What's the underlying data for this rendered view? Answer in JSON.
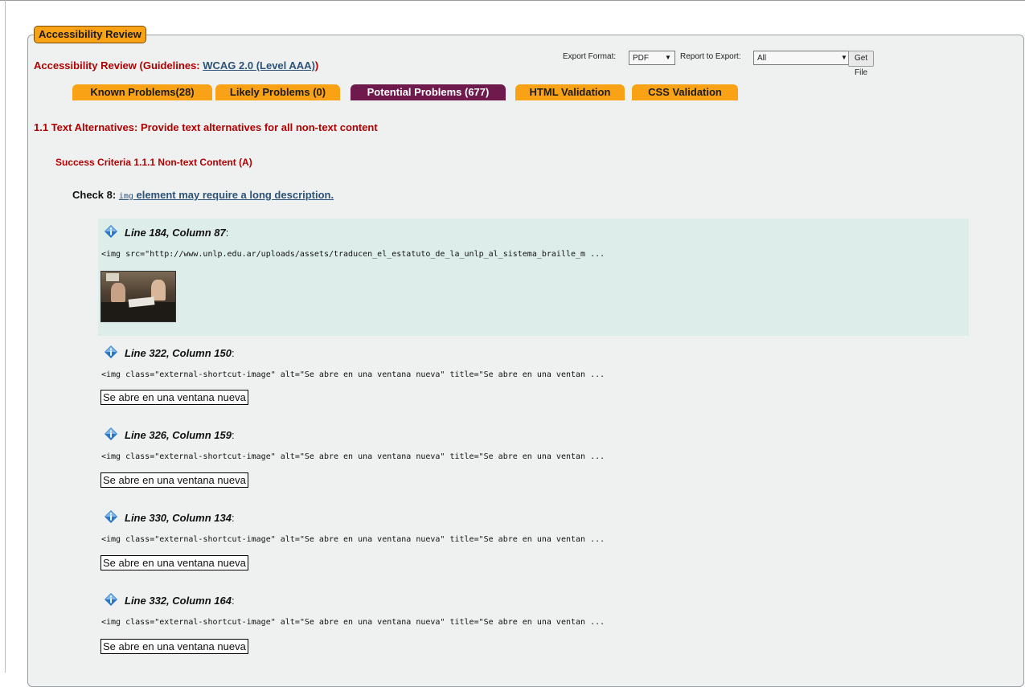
{
  "panel": {
    "legend": "Accessibility Review"
  },
  "title": {
    "prefix": "Accessibility Review (Guidelines: ",
    "link": "WCAG 2.0 (Level AAA)",
    "suffix": ")"
  },
  "export": {
    "format_label": "Export Format:",
    "format_value": "PDF",
    "report_label": "Report to Export:",
    "report_value": "All",
    "button": "Get File"
  },
  "tabs": [
    {
      "label": "Known Problems(28)",
      "active": false
    },
    {
      "label": "Likely Problems (0)",
      "active": false
    },
    {
      "label": "Potential Problems (677)",
      "active": true
    },
    {
      "label": "HTML Validation",
      "active": false
    },
    {
      "label": "CSS Validation",
      "active": false
    }
  ],
  "guideline": "1.1 Text Alternatives: Provide text alternatives for all non-text content",
  "success_criteria": "Success Criteria 1.1.1 Non-text Content (A)",
  "check": {
    "prefix": "Check 8: ",
    "code": "img",
    "link": " element may require a long description."
  },
  "items": [
    {
      "location": "Line 184, Column 87",
      "code": "<img src=\"http://www.unlp.edu.ar/uploads/assets/traducen_el_estatuto_de_la_unlp_al_sistema_braille_m ...",
      "alt": ""
    },
    {
      "location": "Line 322, Column 150",
      "code": "<img class=\"external-shortcut-image\" alt=\"Se abre en una ventana nueva\" title=\"Se abre en una ventan ...",
      "alt": "Se abre en una ventana nueva"
    },
    {
      "location": "Line 326, Column 159",
      "code": "<img class=\"external-shortcut-image\" alt=\"Se abre en una ventana nueva\" title=\"Se abre en una ventan ...",
      "alt": "Se abre en una ventana nueva"
    },
    {
      "location": "Line 330, Column 134",
      "code": "<img class=\"external-shortcut-image\" alt=\"Se abre en una ventana nueva\" title=\"Se abre en una ventan ...",
      "alt": "Se abre en una ventana nueva"
    },
    {
      "location": "Line 332, Column 164",
      "code": "<img class=\"external-shortcut-image\" alt=\"Se abre en una ventana nueva\" title=\"Se abre en una ventan ...",
      "alt": "Se abre en una ventana nueva"
    }
  ],
  "colors": {
    "accent_orange": "#f9a215",
    "active_tab": "#6e1a4d",
    "heading_red": "#b20000",
    "link_blue": "#2c5377",
    "highlight_row": "#ddeeea"
  }
}
